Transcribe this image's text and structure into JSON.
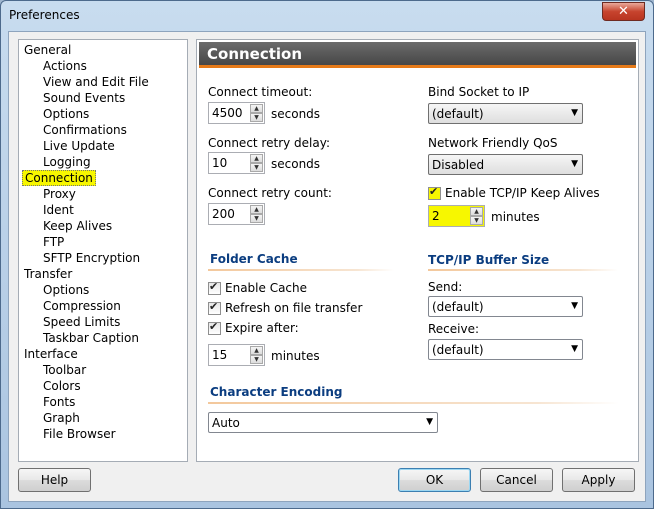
{
  "window": {
    "title": "Preferences",
    "close_glyph": "✕"
  },
  "tree": {
    "items": [
      {
        "label": "General",
        "level": 0
      },
      {
        "label": "Actions",
        "level": 1
      },
      {
        "label": "View and Edit File",
        "level": 1
      },
      {
        "label": "Sound Events",
        "level": 1
      },
      {
        "label": "Options",
        "level": 1
      },
      {
        "label": "Confirmations",
        "level": 1
      },
      {
        "label": "Live Update",
        "level": 1
      },
      {
        "label": "Logging",
        "level": 1
      },
      {
        "label": "Connection",
        "level": 0,
        "selected": true
      },
      {
        "label": "Proxy",
        "level": 1
      },
      {
        "label": "Ident",
        "level": 1
      },
      {
        "label": "Keep Alives",
        "level": 1
      },
      {
        "label": "FTP",
        "level": 1
      },
      {
        "label": "SFTP Encryption",
        "level": 1
      },
      {
        "label": "Transfer",
        "level": 0
      },
      {
        "label": "Options",
        "level": 1
      },
      {
        "label": "Compression",
        "level": 1
      },
      {
        "label": "Speed Limits",
        "level": 1
      },
      {
        "label": "Taskbar Caption",
        "level": 1
      },
      {
        "label": "Interface",
        "level": 0
      },
      {
        "label": "Toolbar",
        "level": 1
      },
      {
        "label": "Colors",
        "level": 1
      },
      {
        "label": "Fonts",
        "level": 1
      },
      {
        "label": "Graph",
        "level": 1
      },
      {
        "label": "File Browser",
        "level": 1
      }
    ]
  },
  "panel": {
    "title": "Connection",
    "connect_timeout": {
      "label": "Connect timeout:",
      "value": "4500",
      "unit": "seconds"
    },
    "connect_retry_delay": {
      "label": "Connect retry delay:",
      "value": "10",
      "unit": "seconds"
    },
    "connect_retry_count": {
      "label": "Connect retry count:",
      "value": "200"
    },
    "bind_socket": {
      "label": "Bind Socket to IP",
      "value": "(default)"
    },
    "qos": {
      "label": "Network Friendly QoS",
      "value": "Disabled"
    },
    "keep_alives": {
      "label": "Enable TCP/IP Keep Alives",
      "checked": true,
      "value": "2",
      "unit": "minutes"
    },
    "folder_cache": {
      "title": "Folder Cache",
      "enable_cache": {
        "label": "Enable Cache",
        "checked": true
      },
      "refresh": {
        "label": "Refresh on file transfer",
        "checked": true
      },
      "expire": {
        "label": "Expire after:",
        "checked": true,
        "value": "15",
        "unit": "minutes"
      }
    },
    "buffer": {
      "title": "TCP/IP Buffer Size",
      "send": {
        "label": "Send:",
        "value": "(default)"
      },
      "receive": {
        "label": "Receive:",
        "value": "(default)"
      }
    },
    "encoding": {
      "title": "Character Encoding",
      "value": "Auto"
    }
  },
  "buttons": {
    "help": "Help",
    "ok": "OK",
    "cancel": "Cancel",
    "apply": "Apply"
  },
  "icons": {
    "spin_up": "▲",
    "spin_down": "▼",
    "dropdown": "▼"
  },
  "colors": {
    "highlight": "#f7f700",
    "accent": "#e57a19",
    "section_title": "#0b3d80"
  }
}
